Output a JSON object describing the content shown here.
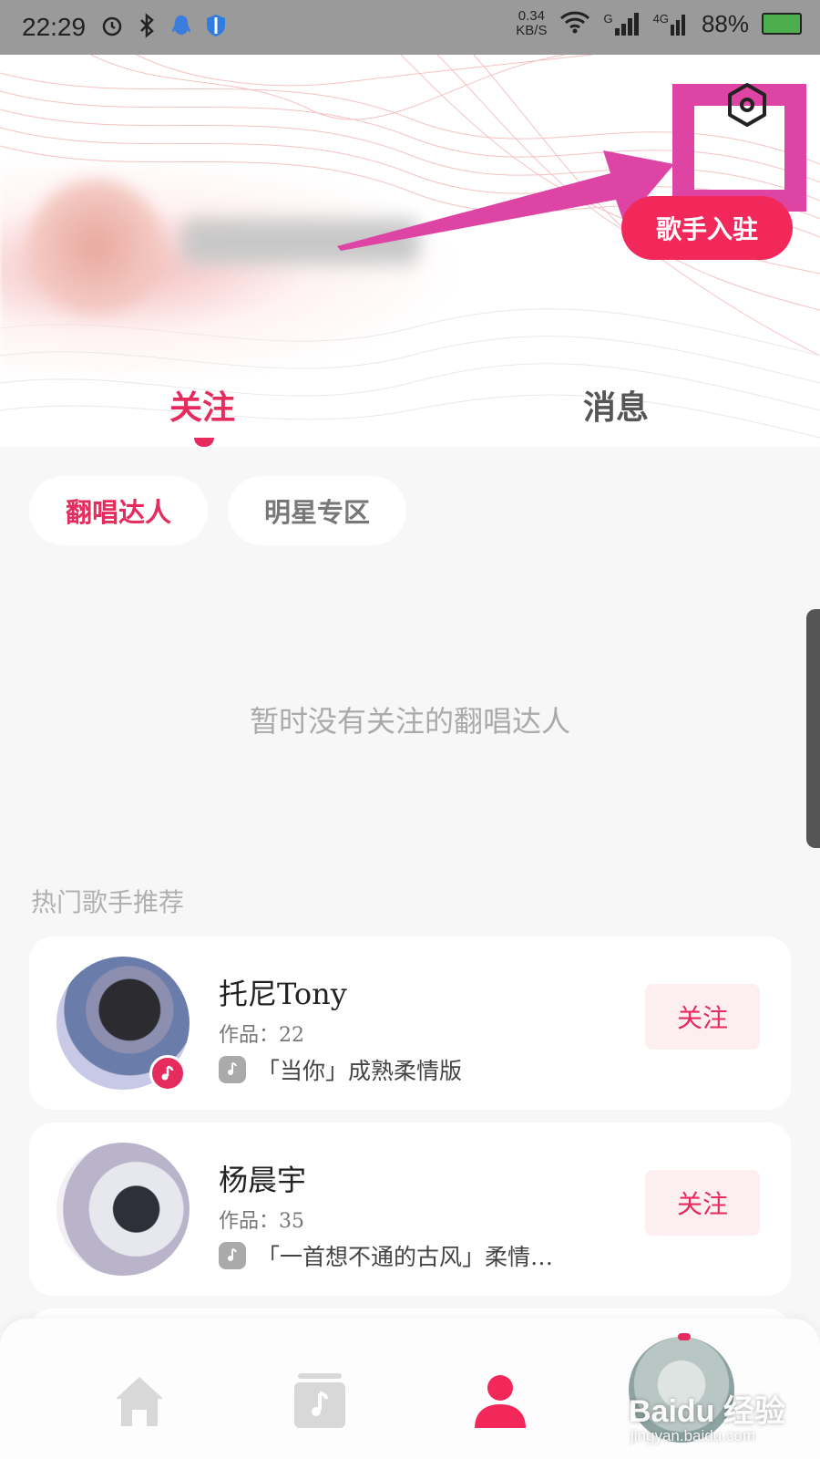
{
  "status_bar": {
    "time": "22:29",
    "net_speed_value": "0.34",
    "net_speed_unit": "KB/S",
    "battery": "88%",
    "signal_1": "G",
    "signal_2": "4G"
  },
  "header": {
    "join_button": "歌手入驻"
  },
  "tabs": [
    {
      "label": "关注",
      "active": true
    },
    {
      "label": "消息",
      "active": false
    }
  ],
  "chips": [
    {
      "label": "翻唱达人",
      "active": true
    },
    {
      "label": "明星专区",
      "active": false
    }
  ],
  "empty_text": "暂时没有关注的翻唱达人",
  "section_title": "热门歌手推荐",
  "singers": [
    {
      "name": "托尼Tony",
      "works": "作品：22",
      "song": "「当你」成熟柔情版",
      "follow": "关注"
    },
    {
      "name": "杨晨宇",
      "works": "作品：35",
      "song": "「一首想不通的古风」柔情…",
      "follow": "关注"
    }
  ],
  "watermark": {
    "brand": "Baidu 经验",
    "url": "jingyan.baidu.com"
  },
  "colors": {
    "accent": "#e62b5d",
    "highlight": "#dd44a3"
  },
  "icons": {
    "settings": "settings-hexagon-icon",
    "home": "home-icon",
    "library": "music-library-icon",
    "profile": "profile-icon"
  }
}
